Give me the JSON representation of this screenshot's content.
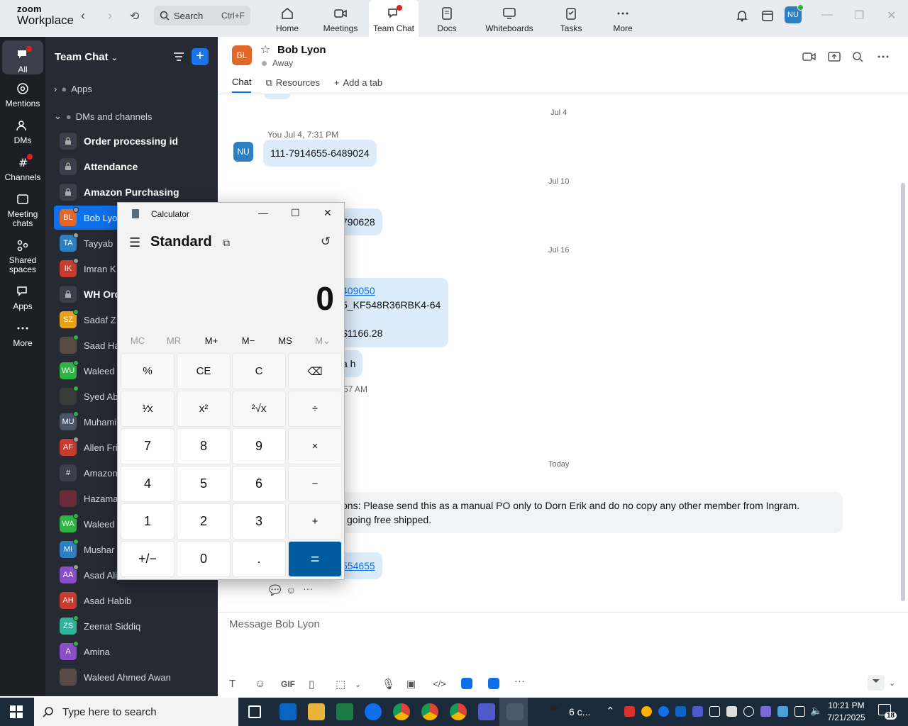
{
  "app": {
    "brand_top": "zoom",
    "brand_bottom": "Workplace"
  },
  "search": {
    "label": "Search",
    "shortcut": "Ctrl+F"
  },
  "top_nav": [
    {
      "label": "Home"
    },
    {
      "label": "Meetings"
    },
    {
      "label": "Team Chat"
    },
    {
      "label": "Docs"
    },
    {
      "label": "Whiteboards"
    },
    {
      "label": "Tasks"
    },
    {
      "label": "More"
    }
  ],
  "user_avatar": "NU",
  "rail": [
    {
      "label": "All"
    },
    {
      "label": "Mentions"
    },
    {
      "label": "DMs"
    },
    {
      "label": "Channels"
    },
    {
      "label": "Meeting chats"
    },
    {
      "label": "Shared spaces"
    },
    {
      "label": "Apps"
    },
    {
      "label": "More"
    }
  ],
  "chatlist": {
    "title": "Team Chat",
    "sections": {
      "apps": "Apps",
      "dms": "DMs and channels"
    },
    "channels": [
      {
        "name": "Order processing id"
      },
      {
        "name": "Attendance"
      },
      {
        "name": "Amazon Purchasing"
      }
    ],
    "contacts": [
      {
        "initials": "BL",
        "name": "Bob Lyo",
        "color": "#e0692a",
        "status": "#9aa0a6"
      },
      {
        "initials": "TA",
        "name": "Tayyab",
        "color": "#2d7fc1",
        "status": "#9aa0a6"
      },
      {
        "initials": "IK",
        "name": "Imran K",
        "color": "#c83c2f",
        "status": "#9aa0a6"
      },
      {
        "initials": "",
        "name": "WH Ord",
        "color": "",
        "status": ""
      },
      {
        "initials": "SZ",
        "name": "Sadaf Z",
        "color": "#e8a21a",
        "status": "#2fb344"
      },
      {
        "initials": "",
        "name": "Saad Ha",
        "color": "#5a4a44",
        "status": "#2fb344"
      },
      {
        "initials": "WU",
        "name": "Waleed",
        "color": "#2fb344",
        "status": "#2fb344"
      },
      {
        "initials": "",
        "name": "Syed Ab",
        "color": "#3b3b3b",
        "status": "#2fb344"
      },
      {
        "initials": "MU",
        "name": "Muhami",
        "color": "#4a5668",
        "status": "#2fb344"
      },
      {
        "initials": "AF",
        "name": "Allen Fri",
        "color": "#c83c2f",
        "status": "#9aa0a6"
      },
      {
        "initials": "#",
        "name": "Amazon",
        "color": "#3a3f4b",
        "status": ""
      },
      {
        "initials": "",
        "name": "Hazama",
        "color": "#6a2a3a",
        "status": ""
      },
      {
        "initials": "WA",
        "name": "Waleed",
        "color": "#2fb344",
        "status": "#2fb344"
      },
      {
        "initials": "MI",
        "name": "Mushar",
        "color": "#2d7fc1",
        "status": "#2fb344"
      },
      {
        "initials": "AA",
        "name": "Asad Ali",
        "color": "#8a4fc7",
        "status": "#9aa0a6"
      },
      {
        "initials": "AH",
        "name": "Asad Habib",
        "color": "#c83c2f",
        "status": ""
      },
      {
        "initials": "ZS",
        "name": "Zeenat Siddiq",
        "color": "#2fb39a",
        "status": "#2fb344"
      },
      {
        "initials": "A",
        "name": "Amina",
        "color": "#8a4fc7",
        "status": "#2fb344"
      },
      {
        "initials": "",
        "name": "Waleed Ahmed Awan",
        "color": "#5a4a44",
        "status": ""
      }
    ]
  },
  "chat": {
    "contact_initials": "BL",
    "contact_name": "Bob Lyon",
    "status": "Away",
    "tabs": [
      "Chat",
      "Resources",
      "Add a tab"
    ],
    "dates": [
      "Jul 4",
      "Jul 10",
      "Jul 16",
      "Today"
    ],
    "messages": {
      "m1_meta": "You Jul 4, 7:31 PM",
      "m1_avatar": "NU",
      "m1_text": "111-7914655-6489024",
      "m2_text": "790628",
      "m2_meta": "",
      "m3_link": "409050",
      "m3_line2": "5_KF548R36RBK4-64",
      "m3_line3": "$1166.28",
      "m4_text": "a h",
      "m5_meta": "57 AM",
      "m6_line1": "ons: Please send this as a manual PO only to Dorn Erik and do no copy any other member from Ingram.",
      "m6_line2": "going free shipped.",
      "m7_link": "554655"
    },
    "composer_placeholder": "Message Bob Lyon",
    "tool_gif": "GIF"
  },
  "calculator": {
    "title": "Calculator",
    "mode": "Standard",
    "display": "0",
    "memory": [
      "MC",
      "MR",
      "M+",
      "M−",
      "MS",
      "M⌄"
    ],
    "keys": [
      [
        "%",
        "CE",
        "C",
        "⌫"
      ],
      [
        "¹⁄x",
        "x²",
        "²√x",
        "÷"
      ],
      [
        "7",
        "8",
        "9",
        "×"
      ],
      [
        "4",
        "5",
        "6",
        "−"
      ],
      [
        "1",
        "2",
        "3",
        "+"
      ],
      [
        "+/−",
        "0",
        ".",
        "="
      ]
    ]
  },
  "taskbar": {
    "search_placeholder": "Type here to search",
    "weather": "6 c...",
    "time": "10:21 PM",
    "date": "7/21/2025",
    "notifications": "18"
  }
}
